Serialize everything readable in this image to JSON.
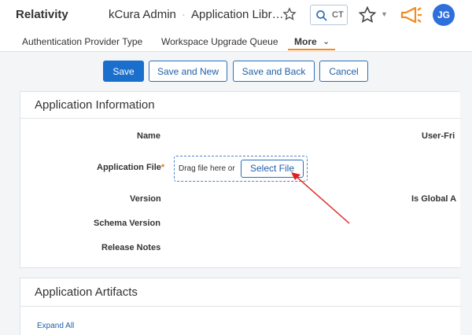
{
  "header": {
    "brand": "Relativity",
    "workspace": "kCura Admin",
    "separator": "·",
    "page": "Application Libr…",
    "search_text": "CT",
    "avatar_initials": "JG",
    "icons": [
      "star-outline-icon",
      "search-icon",
      "star-icon",
      "chevron-down-icon",
      "megaphone-icon"
    ],
    "accent_color": "#f28a1f",
    "avatar_color": "#2f6fdb"
  },
  "tabs": [
    {
      "label": "Authentication Provider Type"
    },
    {
      "label": "Workspace Upgrade Queue"
    },
    {
      "label": "More"
    }
  ],
  "toolbar": {
    "save": "Save",
    "save_and_new": "Save and New",
    "save_and_back": "Save and Back",
    "cancel": "Cancel",
    "primary_color": "#1a6fcd"
  },
  "app_info": {
    "title": "Application Information",
    "fields": {
      "name": "Name",
      "application_file": "Application File",
      "required_marker": "*",
      "version": "Version",
      "schema_version": "Schema Version",
      "release_notes": "Release Notes",
      "user_friendly": "User-Fri",
      "is_global": "Is Global A"
    },
    "dropzone": {
      "text": "Drag file here or",
      "button": "Select File"
    }
  },
  "artifacts": {
    "title": "Application Artifacts",
    "expand_all": "Expand All"
  }
}
